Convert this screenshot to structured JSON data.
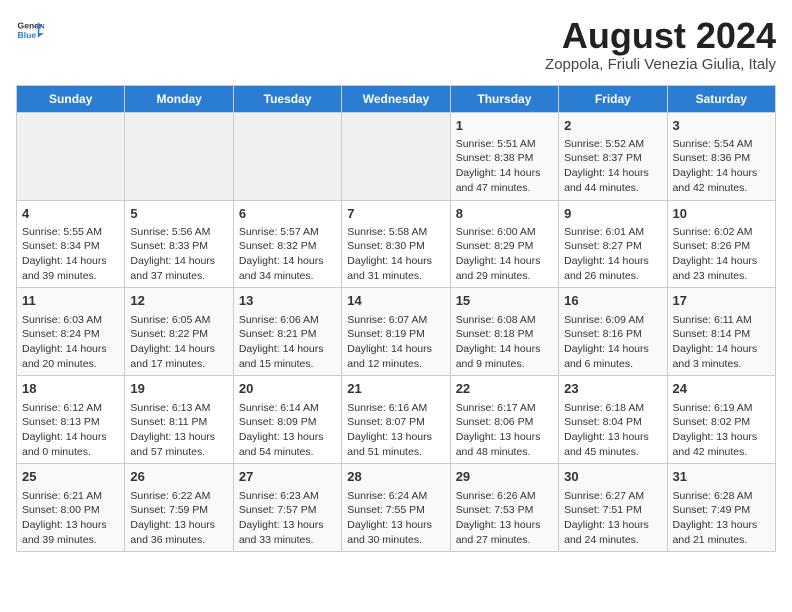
{
  "header": {
    "logo_line1": "General",
    "logo_line2": "Blue",
    "title": "August 2024",
    "subtitle": "Zoppola, Friuli Venezia Giulia, Italy"
  },
  "days_of_week": [
    "Sunday",
    "Monday",
    "Tuesday",
    "Wednesday",
    "Thursday",
    "Friday",
    "Saturday"
  ],
  "weeks": [
    [
      {
        "day": "",
        "info": ""
      },
      {
        "day": "",
        "info": ""
      },
      {
        "day": "",
        "info": ""
      },
      {
        "day": "",
        "info": ""
      },
      {
        "day": "1",
        "info": "Sunrise: 5:51 AM\nSunset: 8:38 PM\nDaylight: 14 hours and 47 minutes."
      },
      {
        "day": "2",
        "info": "Sunrise: 5:52 AM\nSunset: 8:37 PM\nDaylight: 14 hours and 44 minutes."
      },
      {
        "day": "3",
        "info": "Sunrise: 5:54 AM\nSunset: 8:36 PM\nDaylight: 14 hours and 42 minutes."
      }
    ],
    [
      {
        "day": "4",
        "info": "Sunrise: 5:55 AM\nSunset: 8:34 PM\nDaylight: 14 hours and 39 minutes."
      },
      {
        "day": "5",
        "info": "Sunrise: 5:56 AM\nSunset: 8:33 PM\nDaylight: 14 hours and 37 minutes."
      },
      {
        "day": "6",
        "info": "Sunrise: 5:57 AM\nSunset: 8:32 PM\nDaylight: 14 hours and 34 minutes."
      },
      {
        "day": "7",
        "info": "Sunrise: 5:58 AM\nSunset: 8:30 PM\nDaylight: 14 hours and 31 minutes."
      },
      {
        "day": "8",
        "info": "Sunrise: 6:00 AM\nSunset: 8:29 PM\nDaylight: 14 hours and 29 minutes."
      },
      {
        "day": "9",
        "info": "Sunrise: 6:01 AM\nSunset: 8:27 PM\nDaylight: 14 hours and 26 minutes."
      },
      {
        "day": "10",
        "info": "Sunrise: 6:02 AM\nSunset: 8:26 PM\nDaylight: 14 hours and 23 minutes."
      }
    ],
    [
      {
        "day": "11",
        "info": "Sunrise: 6:03 AM\nSunset: 8:24 PM\nDaylight: 14 hours and 20 minutes."
      },
      {
        "day": "12",
        "info": "Sunrise: 6:05 AM\nSunset: 8:22 PM\nDaylight: 14 hours and 17 minutes."
      },
      {
        "day": "13",
        "info": "Sunrise: 6:06 AM\nSunset: 8:21 PM\nDaylight: 14 hours and 15 minutes."
      },
      {
        "day": "14",
        "info": "Sunrise: 6:07 AM\nSunset: 8:19 PM\nDaylight: 14 hours and 12 minutes."
      },
      {
        "day": "15",
        "info": "Sunrise: 6:08 AM\nSunset: 8:18 PM\nDaylight: 14 hours and 9 minutes."
      },
      {
        "day": "16",
        "info": "Sunrise: 6:09 AM\nSunset: 8:16 PM\nDaylight: 14 hours and 6 minutes."
      },
      {
        "day": "17",
        "info": "Sunrise: 6:11 AM\nSunset: 8:14 PM\nDaylight: 14 hours and 3 minutes."
      }
    ],
    [
      {
        "day": "18",
        "info": "Sunrise: 6:12 AM\nSunset: 8:13 PM\nDaylight: 14 hours and 0 minutes."
      },
      {
        "day": "19",
        "info": "Sunrise: 6:13 AM\nSunset: 8:11 PM\nDaylight: 13 hours and 57 minutes."
      },
      {
        "day": "20",
        "info": "Sunrise: 6:14 AM\nSunset: 8:09 PM\nDaylight: 13 hours and 54 minutes."
      },
      {
        "day": "21",
        "info": "Sunrise: 6:16 AM\nSunset: 8:07 PM\nDaylight: 13 hours and 51 minutes."
      },
      {
        "day": "22",
        "info": "Sunrise: 6:17 AM\nSunset: 8:06 PM\nDaylight: 13 hours and 48 minutes."
      },
      {
        "day": "23",
        "info": "Sunrise: 6:18 AM\nSunset: 8:04 PM\nDaylight: 13 hours and 45 minutes."
      },
      {
        "day": "24",
        "info": "Sunrise: 6:19 AM\nSunset: 8:02 PM\nDaylight: 13 hours and 42 minutes."
      }
    ],
    [
      {
        "day": "25",
        "info": "Sunrise: 6:21 AM\nSunset: 8:00 PM\nDaylight: 13 hours and 39 minutes."
      },
      {
        "day": "26",
        "info": "Sunrise: 6:22 AM\nSunset: 7:59 PM\nDaylight: 13 hours and 36 minutes."
      },
      {
        "day": "27",
        "info": "Sunrise: 6:23 AM\nSunset: 7:57 PM\nDaylight: 13 hours and 33 minutes."
      },
      {
        "day": "28",
        "info": "Sunrise: 6:24 AM\nSunset: 7:55 PM\nDaylight: 13 hours and 30 minutes."
      },
      {
        "day": "29",
        "info": "Sunrise: 6:26 AM\nSunset: 7:53 PM\nDaylight: 13 hours and 27 minutes."
      },
      {
        "day": "30",
        "info": "Sunrise: 6:27 AM\nSunset: 7:51 PM\nDaylight: 13 hours and 24 minutes."
      },
      {
        "day": "31",
        "info": "Sunrise: 6:28 AM\nSunset: 7:49 PM\nDaylight: 13 hours and 21 minutes."
      }
    ]
  ]
}
